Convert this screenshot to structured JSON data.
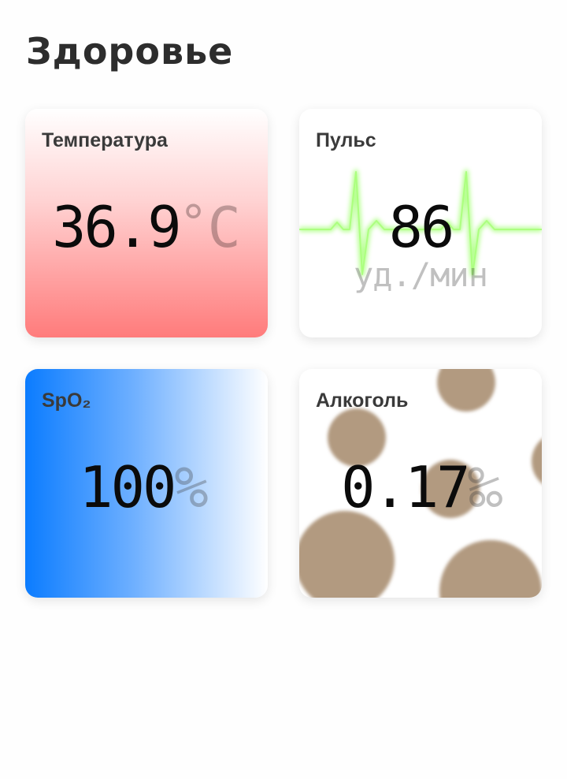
{
  "page": {
    "title": "Здоровье"
  },
  "cards": {
    "temperature": {
      "title": "Температура",
      "value": "36.9",
      "degree": "°",
      "unit": "C"
    },
    "pulse": {
      "title": "Пульс",
      "value": "86",
      "unit": "уд./мин"
    },
    "spo2": {
      "title": "SpO₂",
      "value": "100",
      "unit": "%"
    },
    "alcohol": {
      "title": "Алкоголь",
      "value": "0.17",
      "unit": "‰"
    }
  },
  "colors": {
    "temperature_gradient": [
      "#ffffff",
      "#ff7b7b"
    ],
    "spo2_gradient": [
      "#0b7cff",
      "#ffffff"
    ],
    "pulse_line": "#9dff6a",
    "alcohol_bubbles": "#b29a80"
  }
}
